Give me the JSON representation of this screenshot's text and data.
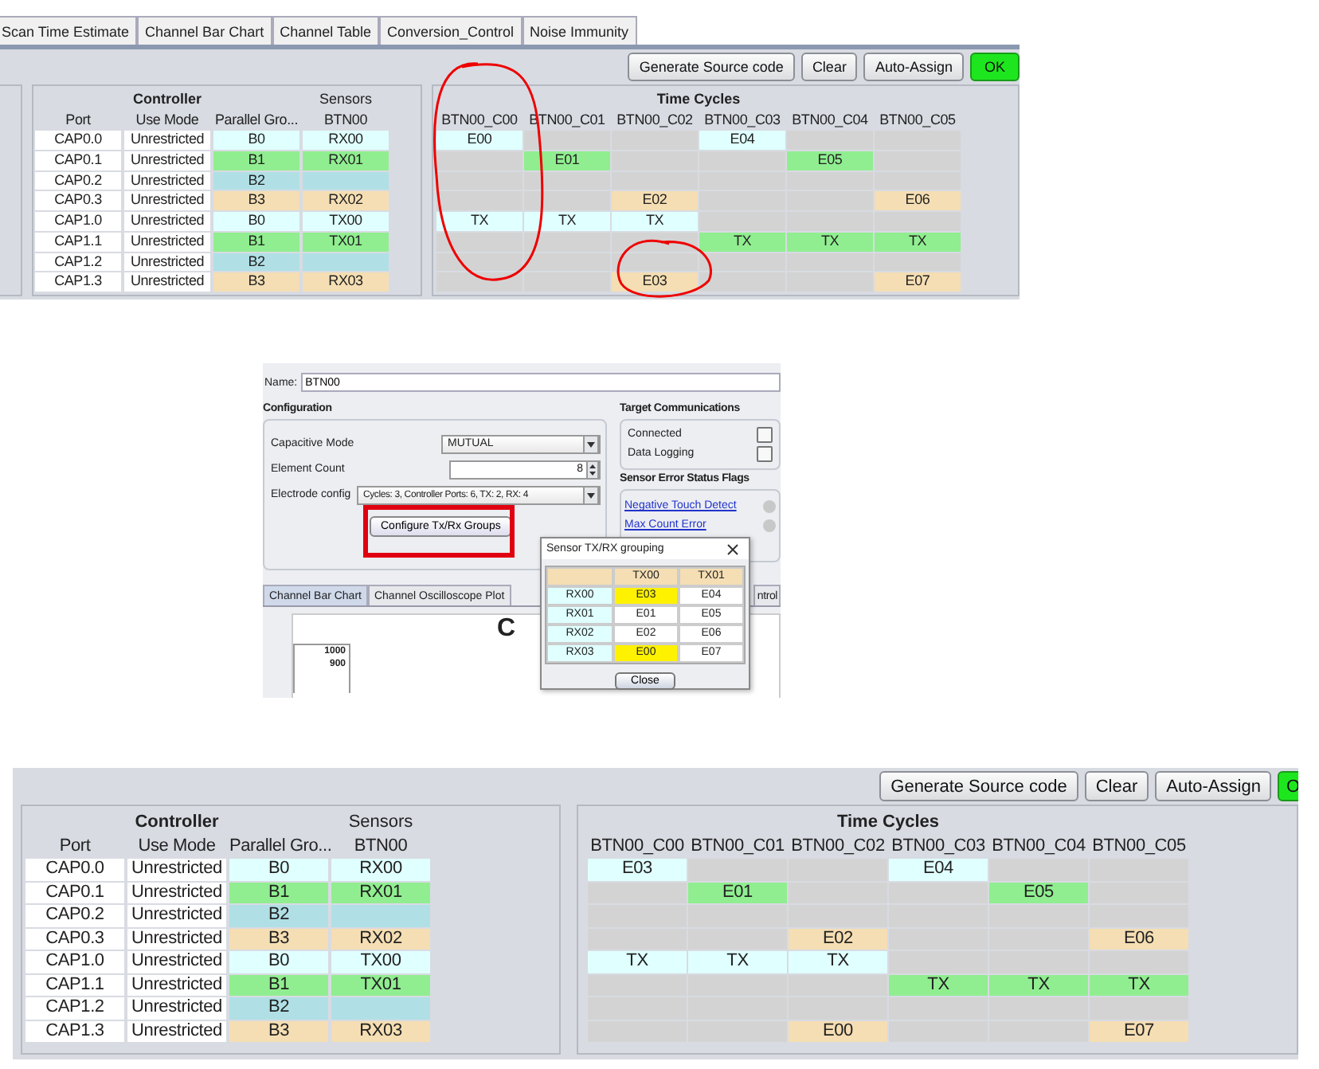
{
  "top_view": {
    "tabs": [
      {
        "label": "Scan Time Estimate",
        "selected": false
      },
      {
        "label": "Channel Bar Chart",
        "selected": false
      },
      {
        "label": "Channel Table",
        "selected": false
      },
      {
        "label": "Conversion_Control",
        "selected": false
      },
      {
        "label": "Noise Immunity",
        "selected": false
      }
    ],
    "buttons": [
      {
        "label": "Generate Source code",
        "kind": "normal"
      },
      {
        "label": "Clear",
        "kind": "normal"
      },
      {
        "label": "Auto-Assign",
        "kind": "normal"
      },
      {
        "label": "OK",
        "kind": "confirm"
      }
    ],
    "controller_table": {
      "controller_header": "Controller",
      "sensors_header": "Sensors",
      "columns": [
        "Port",
        "Use Mode",
        "Parallel Gro...",
        "BTN00"
      ],
      "rows": [
        {
          "port": "CAP0.0",
          "use_mode": "Unrestricted",
          "group": {
            "text": "B0",
            "color": "#e0ffff"
          },
          "sensor": {
            "text": "RX00",
            "color": "#e0ffff"
          }
        },
        {
          "port": "CAP0.1",
          "use_mode": "Unrestricted",
          "group": {
            "text": "B1",
            "color": "#90ee90"
          },
          "sensor": {
            "text": "RX01",
            "color": "#90ee90"
          }
        },
        {
          "port": "CAP0.2",
          "use_mode": "Unrestricted",
          "group": {
            "text": "B2",
            "color": "#b0e0e6"
          },
          "sensor": {
            "color": "#b0e0e6"
          }
        },
        {
          "port": "CAP0.3",
          "use_mode": "Unrestricted",
          "group": {
            "text": "B3",
            "color": "#f5deb3"
          },
          "sensor": {
            "text": "RX02",
            "color": "#f5deb3"
          }
        },
        {
          "port": "CAP1.0",
          "use_mode": "Unrestricted",
          "group": {
            "text": "B0",
            "color": "#e0ffff"
          },
          "sensor": {
            "text": "TX00",
            "color": "#e0ffff"
          }
        },
        {
          "port": "CAP1.1",
          "use_mode": "Unrestricted",
          "group": {
            "text": "B1",
            "color": "#90ee90"
          },
          "sensor": {
            "text": "TX01",
            "color": "#90ee90"
          }
        },
        {
          "port": "CAP1.2",
          "use_mode": "Unrestricted",
          "group": {
            "text": "B2",
            "color": "#b0e0e6"
          },
          "sensor": {
            "color": "#b0e0e6"
          }
        },
        {
          "port": "CAP1.3",
          "use_mode": "Unrestricted",
          "group": {
            "text": "B3",
            "color": "#f5deb3"
          },
          "sensor": {
            "text": "RX03",
            "color": "#f5deb3"
          }
        }
      ]
    },
    "time_cycles": {
      "title": "Time Cycles",
      "columns": [
        "BTN00_C00",
        "BTN00_C01",
        "BTN00_C02",
        "BTN00_C03",
        "BTN00_C04",
        "BTN00_C05"
      ],
      "rows": [
        [
          {
            "text": "E00",
            "color": "#e0ffff"
          },
          {
            "color": "#d3d3d3"
          },
          {
            "color": "#d3d3d3"
          },
          {
            "text": "E04",
            "color": "#e0ffff"
          },
          {
            "color": "#d3d3d3"
          },
          {
            "color": "#d3d3d3"
          }
        ],
        [
          {
            "color": "#d3d3d3"
          },
          {
            "text": "E01",
            "color": "#90ee90"
          },
          {
            "color": "#d3d3d3"
          },
          {
            "color": "#d3d3d3"
          },
          {
            "text": "E05",
            "color": "#90ee90"
          },
          {
            "color": "#d3d3d3"
          }
        ],
        [
          {
            "color": "#d3d3d3"
          },
          {
            "color": "#d3d3d3"
          },
          {
            "color": "#d3d3d3"
          },
          {
            "color": "#d3d3d3"
          },
          {
            "color": "#d3d3d3"
          },
          {
            "color": "#d3d3d3"
          }
        ],
        [
          {
            "color": "#d3d3d3"
          },
          {
            "color": "#d3d3d3"
          },
          {
            "text": "E02",
            "color": "#f5deb3"
          },
          {
            "color": "#d3d3d3"
          },
          {
            "color": "#d3d3d3"
          },
          {
            "text": "E06",
            "color": "#f5deb3"
          }
        ],
        [
          {
            "text": "TX",
            "color": "#e0ffff"
          },
          {
            "text": "TX",
            "color": "#e0ffff"
          },
          {
            "text": "TX",
            "color": "#e0ffff"
          },
          {
            "color": "#d3d3d3"
          },
          {
            "color": "#d3d3d3"
          },
          {
            "color": "#d3d3d3"
          }
        ],
        [
          {
            "color": "#d3d3d3"
          },
          {
            "color": "#d3d3d3"
          },
          {
            "color": "#d3d3d3"
          },
          {
            "text": "TX",
            "color": "#90ee90"
          },
          {
            "text": "TX",
            "color": "#90ee90"
          },
          {
            "text": "TX",
            "color": "#90ee90"
          }
        ],
        [
          {
            "color": "#d3d3d3"
          },
          {
            "color": "#d3d3d3"
          },
          {
            "color": "#d3d3d3"
          },
          {
            "color": "#d3d3d3"
          },
          {
            "color": "#d3d3d3"
          },
          {
            "color": "#d3d3d3"
          }
        ],
        [
          {
            "color": "#d3d3d3"
          },
          {
            "color": "#d3d3d3"
          },
          {
            "text": "E03",
            "color": "#f5deb3"
          },
          {
            "color": "#d3d3d3"
          },
          {
            "color": "#d3d3d3"
          },
          {
            "text": "E07",
            "color": "#f5deb3"
          }
        ]
      ]
    }
  },
  "dialog_view": {
    "name_label": "Name:",
    "name_value": "BTN00",
    "configuration": {
      "title": "Configuration",
      "capacitive_mode": {
        "label": "Capacitive Mode",
        "value": "MUTUAL"
      },
      "element_count": {
        "label": "Element Count",
        "value": "8"
      },
      "electrode_config": {
        "label": "Electrode config",
        "value": "Cycles: 3, Controller Ports: 6, TX: 2, RX: 4"
      },
      "button": "Configure Tx/Rx Groups"
    },
    "target_communications": {
      "title": "Target Communications",
      "items": [
        {
          "label": "Connected",
          "checked": false
        },
        {
          "label": "Data Logging",
          "checked": false
        }
      ]
    },
    "sensor_error_flags": {
      "title": "Sensor Error Status Flags",
      "items": [
        "Negative Touch Detect",
        "Max Count Error"
      ]
    },
    "tabs": [
      {
        "label": "Channel Bar Chart",
        "selected": true
      },
      {
        "label": "Channel Oscilloscope Plot",
        "selected": false
      },
      {
        "label": "ntrol",
        "selected": false
      }
    ],
    "chart": {
      "title": "C",
      "yticks": [
        "1000",
        "900"
      ]
    },
    "dialog": {
      "title": "Sensor TX/RX grouping",
      "columns": [
        "TX00",
        "TX01"
      ],
      "rows": [
        {
          "label": "RX00",
          "cells": [
            {
              "text": "E03",
              "highlighted": true
            },
            {
              "text": "E04",
              "highlighted": false
            }
          ]
        },
        {
          "label": "RX01",
          "cells": [
            {
              "text": "E01",
              "highlighted": false
            },
            {
              "text": "E05",
              "highlighted": false
            }
          ]
        },
        {
          "label": "RX02",
          "cells": [
            {
              "text": "E02",
              "highlighted": false
            },
            {
              "text": "E06",
              "highlighted": false
            }
          ]
        },
        {
          "label": "RX03",
          "cells": [
            {
              "text": "E00",
              "highlighted": true
            },
            {
              "text": "E07",
              "highlighted": false
            }
          ]
        }
      ],
      "button": "Close"
    }
  },
  "bottom_view": {
    "buttons": [
      {
        "label": "Generate Source code",
        "kind": "normal"
      },
      {
        "label": "Clear",
        "kind": "normal"
      },
      {
        "label": "Auto-Assign",
        "kind": "normal"
      },
      {
        "label": "O",
        "kind": "confirm"
      }
    ],
    "controller_table": {
      "controller_header": "Controller",
      "sensors_header": "Sensors",
      "columns": [
        "Port",
        "Use Mode",
        "Parallel Gro...",
        "BTN00"
      ],
      "rows": [
        {
          "port": "CAP0.0",
          "use_mode": "Unrestricted",
          "group": {
            "text": "B0",
            "color": "#e0ffff"
          },
          "sensor": {
            "text": "RX00",
            "color": "#e0ffff"
          }
        },
        {
          "port": "CAP0.1",
          "use_mode": "Unrestricted",
          "group": {
            "text": "B1",
            "color": "#90ee90"
          },
          "sensor": {
            "text": "RX01",
            "color": "#90ee90"
          }
        },
        {
          "port": "CAP0.2",
          "use_mode": "Unrestricted",
          "group": {
            "text": "B2",
            "color": "#b0e0e6"
          },
          "sensor": {
            "color": "#b0e0e6"
          }
        },
        {
          "port": "CAP0.3",
          "use_mode": "Unrestricted",
          "group": {
            "text": "B3",
            "color": "#f5deb3"
          },
          "sensor": {
            "text": "RX02",
            "color": "#f5deb3"
          }
        },
        {
          "port": "CAP1.0",
          "use_mode": "Unrestricted",
          "group": {
            "text": "B0",
            "color": "#e0ffff"
          },
          "sensor": {
            "text": "TX00",
            "color": "#e0ffff"
          }
        },
        {
          "port": "CAP1.1",
          "use_mode": "Unrestricted",
          "group": {
            "text": "B1",
            "color": "#90ee90"
          },
          "sensor": {
            "text": "TX01",
            "color": "#90ee90"
          }
        },
        {
          "port": "CAP1.2",
          "use_mode": "Unrestricted",
          "group": {
            "text": "B2",
            "color": "#b0e0e6"
          },
          "sensor": {
            "color": "#b0e0e6"
          }
        },
        {
          "port": "CAP1.3",
          "use_mode": "Unrestricted",
          "group": {
            "text": "B3",
            "color": "#f5deb3"
          },
          "sensor": {
            "text": "RX03",
            "color": "#f5deb3"
          }
        }
      ]
    },
    "time_cycles": {
      "title": "Time Cycles",
      "columns": [
        "BTN00_C00",
        "BTN00_C01",
        "BTN00_C02",
        "BTN00_C03",
        "BTN00_C04",
        "BTN00_C05"
      ],
      "rows": [
        [
          {
            "text": "E03",
            "color": "#e0ffff"
          },
          {
            "color": "#d3d3d3"
          },
          {
            "color": "#d3d3d3"
          },
          {
            "text": "E04",
            "color": "#e0ffff"
          },
          {
            "color": "#d3d3d3"
          },
          {
            "color": "#d3d3d3"
          }
        ],
        [
          {
            "color": "#d3d3d3"
          },
          {
            "text": "E01",
            "color": "#90ee90"
          },
          {
            "color": "#d3d3d3"
          },
          {
            "color": "#d3d3d3"
          },
          {
            "text": "E05",
            "color": "#90ee90"
          },
          {
            "color": "#d3d3d3"
          }
        ],
        [
          {
            "color": "#d3d3d3"
          },
          {
            "color": "#d3d3d3"
          },
          {
            "color": "#d3d3d3"
          },
          {
            "color": "#d3d3d3"
          },
          {
            "color": "#d3d3d3"
          },
          {
            "color": "#d3d3d3"
          }
        ],
        [
          {
            "color": "#d3d3d3"
          },
          {
            "color": "#d3d3d3"
          },
          {
            "text": "E02",
            "color": "#f5deb3"
          },
          {
            "color": "#d3d3d3"
          },
          {
            "color": "#d3d3d3"
          },
          {
            "text": "E06",
            "color": "#f5deb3"
          }
        ],
        [
          {
            "text": "TX",
            "color": "#e0ffff"
          },
          {
            "text": "TX",
            "color": "#e0ffff"
          },
          {
            "text": "TX",
            "color": "#e0ffff"
          },
          {
            "color": "#d3d3d3"
          },
          {
            "color": "#d3d3d3"
          },
          {
            "color": "#d3d3d3"
          }
        ],
        [
          {
            "color": "#d3d3d3"
          },
          {
            "color": "#d3d3d3"
          },
          {
            "color": "#d3d3d3"
          },
          {
            "text": "TX",
            "color": "#90ee90"
          },
          {
            "text": "TX",
            "color": "#90ee90"
          },
          {
            "text": "TX",
            "color": "#90ee90"
          }
        ],
        [
          {
            "color": "#d3d3d3"
          },
          {
            "color": "#d3d3d3"
          },
          {
            "color": "#d3d3d3"
          },
          {
            "color": "#d3d3d3"
          },
          {
            "color": "#d3d3d3"
          },
          {
            "color": "#d3d3d3"
          }
        ],
        [
          {
            "color": "#d3d3d3"
          },
          {
            "color": "#d3d3d3"
          },
          {
            "text": "E00",
            "color": "#f5deb3"
          },
          {
            "color": "#d3d3d3"
          },
          {
            "color": "#d3d3d3"
          },
          {
            "text": "E07",
            "color": "#f5deb3"
          }
        ]
      ]
    }
  }
}
